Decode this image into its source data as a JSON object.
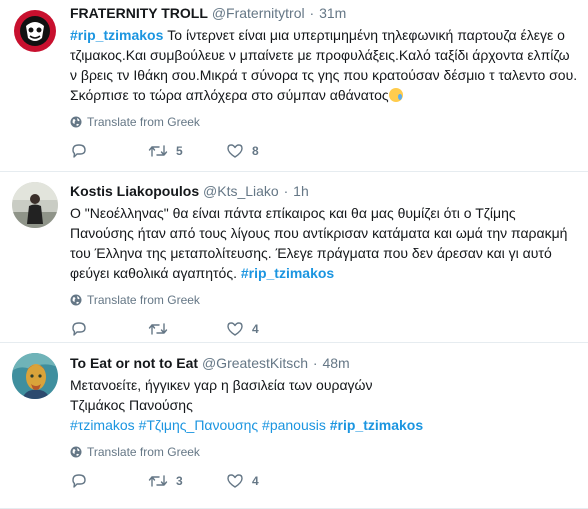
{
  "tweets": [
    {
      "name": "FRATERNITY TROLL",
      "handle": "@Fraternitytrol",
      "dot": "·",
      "time": "31m",
      "text_parts": {
        "hashtag": "#rip_tzimakos",
        "body": " Το ίντερνετ είναι μια υπερτιμημένη τηλεφωνική παρτουζα έλεγε ο τζιμακος.Και συμβούλευε ν μπαίνετε με προφυλάξεις.Καλό ταξίδι άρχοντα ελπίζω ν βρεις τν Ιθάκη σου.Μικρά τ σύνορα τς γης που κρατούσαν δέσμιο τ ταλεντο σου. Σκόρπισε το τώρα απλόχερα στο σύμπαν αθάνατος",
        "emoji": "sad-but-relieved-face"
      },
      "translate": "Translate from Greek",
      "reply_count": "",
      "retweet_count": "5",
      "like_count": "8"
    },
    {
      "name": "Kostis Liakopoulos",
      "handle": "@Kts_Liako",
      "dot": "·",
      "time": "1h",
      "text_parts": {
        "body": "Ο \"Νεοέλληνας\" θα είναι πάντα επίκαιρος και θα μας θυμίζει ότι ο Τζίμης Πανούσης ήταν από τους λίγους που αντίκρισαν κατάματα και ωμά την παρακμή του Έλληνα της μεταπολίτευσης. Έλεγε πράγματα που δεν άρεσαν και γι αυτό φεύγει καθολικά αγαπητός. ",
        "hashtag": "#rip_tzimakos"
      },
      "translate": "Translate from Greek",
      "reply_count": "",
      "retweet_count": "",
      "like_count": "4"
    },
    {
      "name": "To Eat or not to Eat",
      "handle": "@GreatestKitsch",
      "dot": "·",
      "time": "48m",
      "text_parts": {
        "line1": "Μετανοείτε, ήγγικεν γαρ η βασιλεία των ουραγών",
        "line2": "Τζιμάκος Πανούσης",
        "tag1": "#τzimakos",
        "tag2": "#Τζιμης_Πανουσης",
        "tag3": "#panousis",
        "hashtag": "#rip_tzimakos"
      },
      "translate": "Translate from Greek",
      "reply_count": "",
      "retweet_count": "3",
      "like_count": "4"
    }
  ],
  "icons": {
    "globe": "globe-icon",
    "reply": "reply-icon",
    "retweet": "retweet-icon",
    "like": "heart-icon"
  },
  "colors": {
    "link": "#1b95e0",
    "muted": "#657786",
    "text": "#14171a",
    "divider": "#e6ecf0"
  }
}
